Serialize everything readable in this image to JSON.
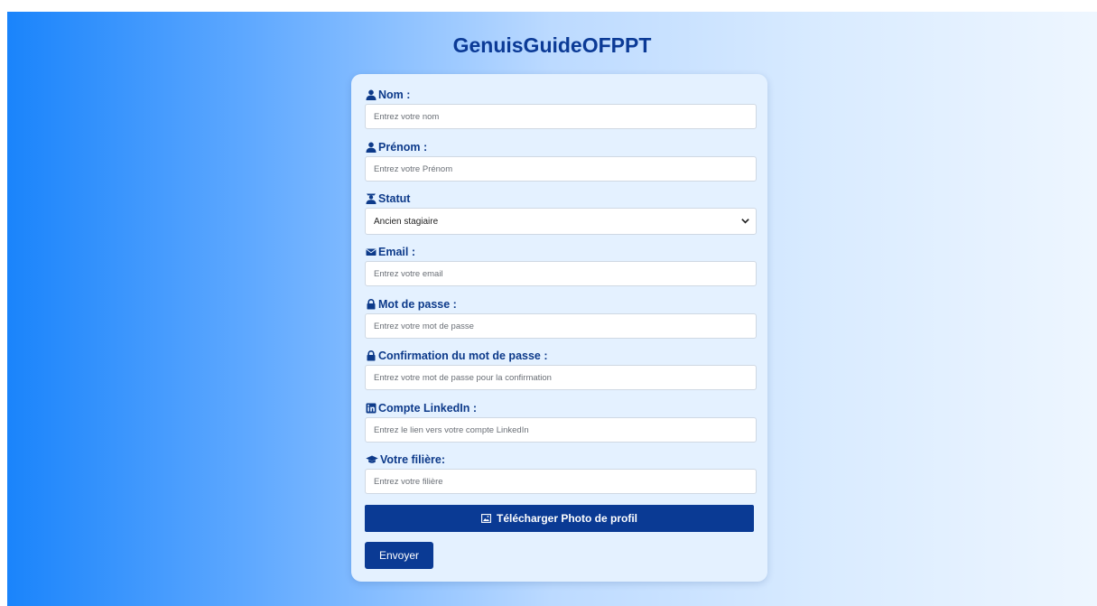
{
  "app_title": "GenuisGuideOFPPT",
  "form": {
    "nom": {
      "label": "Nom :",
      "placeholder": "Entrez votre nom",
      "icon": "user-icon"
    },
    "prenom": {
      "label": "Prénom :",
      "placeholder": "Entrez votre Prénom",
      "icon": "user-icon"
    },
    "statut": {
      "label": "Statut",
      "value": "Ancien stagiaire",
      "icon": "graduate-icon"
    },
    "email": {
      "label": "Email :",
      "placeholder": "Entrez votre email",
      "icon": "envelope-icon"
    },
    "password": {
      "label": "Mot de passe :",
      "placeholder": "Entrez votre mot de passe",
      "icon": "lock-icon"
    },
    "password_confirm": {
      "label": "Confirmation du mot de passe :",
      "placeholder": "Entrez votre mot de passe pour la confirmation",
      "icon": "lock-icon"
    },
    "linkedin": {
      "label": "Compte LinkedIn :",
      "placeholder": "Entrez le lien vers votre compte LinkedIn",
      "icon": "linkedin-icon"
    },
    "filiere": {
      "label": "Votre filière:",
      "placeholder": "Entrez votre filière",
      "icon": "graduation-cap-icon"
    },
    "upload_label": "Télécharger Photo de profil",
    "submit_label": "Envoyer"
  },
  "colors": {
    "accent": "#0a3a94",
    "title": "#0b3a96",
    "label": "#0d3a8a",
    "card": "#e4f1ff"
  }
}
